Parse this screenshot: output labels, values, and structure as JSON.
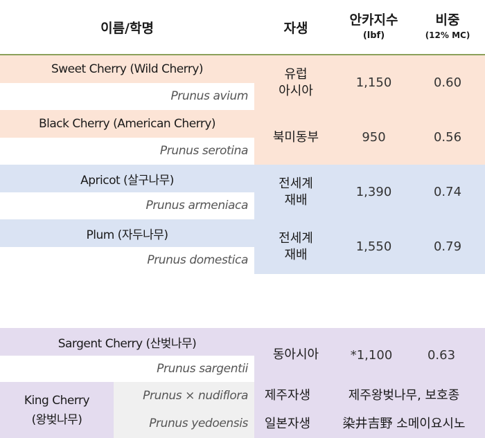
{
  "colors": {
    "peach": "#fce4d6",
    "lavender": "#dae3f3",
    "purple": "#e4dcef",
    "gray": "#f0f0f0",
    "header_rule": "#8aa05a"
  },
  "header": {
    "name": "이름/학명",
    "origin": "자생",
    "hardness": "안카지수",
    "hardness_unit": "(lbf)",
    "gravity": "비중",
    "gravity_unit": "(12% MC)"
  },
  "rows": [
    {
      "name": "Sweet Cherry (Wild Cherry)",
      "sci": "Prunus avium",
      "origin_line1": "유럽",
      "origin_line2": "아시아",
      "hardness": "1,150",
      "gravity": "0.60"
    },
    {
      "name": "Black Cherry (American Cherry)",
      "sci": "Prunus serotina",
      "origin_line1": "북미동부",
      "hardness": "950",
      "gravity": "0.56"
    },
    {
      "name": "Apricot (살구나무)",
      "sci": "Prunus armeniaca",
      "origin_line1": "전세계",
      "origin_line2": "재배",
      "hardness": "1,390",
      "gravity": "0.74"
    },
    {
      "name": "Plum (자두나무)",
      "sci": "Prunus domestica",
      "origin_line1": "전세계",
      "origin_line2": "재배",
      "hardness": "1,550",
      "gravity": "0.79"
    }
  ],
  "sargent": {
    "name": "Sargent Cherry (산벚나무)",
    "sci": "Prunus sargentii",
    "origin": "동아시아",
    "hardness": "*1,100",
    "gravity": "0.63"
  },
  "king": {
    "name_line1": "King Cherry",
    "name_line2": "(왕벚나무)",
    "sci1": "Prunus × nudiflora",
    "origin1": "제주자생",
    "note1": "제주왕벚나무, 보호종",
    "sci2": "Prunus yedoensis",
    "origin2": "일본자생",
    "note2": "染井吉野 소메이요시노"
  }
}
